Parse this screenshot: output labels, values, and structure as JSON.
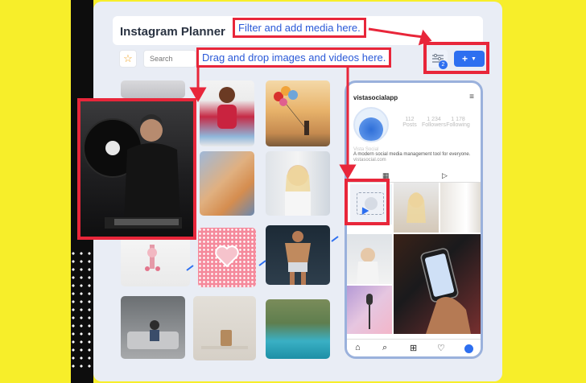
{
  "app": {
    "title": "Instagram Planner"
  },
  "toolbar": {
    "search_placeholder": "Search",
    "filter_count": "2",
    "add_label": "+",
    "add_caret": "▼"
  },
  "annotations": {
    "filter_note": "Filter and add media here.",
    "drag_note": "Drag and drop images and videos here."
  },
  "icons": {
    "star": "star-icon",
    "filter": "filter-icon",
    "plus": "plus-icon",
    "home": "home-icon",
    "search": "search-icon",
    "add": "add-post-icon",
    "heart": "heart-icon",
    "profile": "profile-icon",
    "grid": "grid-icon",
    "reels": "reels-icon",
    "menu": "menu-icon"
  },
  "phone": {
    "username": "vistasocialapp",
    "stats": [
      {
        "value": "112",
        "label": "Posts"
      },
      {
        "value": "1 234",
        "label": "Followers"
      },
      {
        "value": "1 178",
        "label": "Following"
      }
    ],
    "name": "Vista Social",
    "bio": "A modern social media management tool for everyone.",
    "website": "vistasocial.com",
    "nav_glyphs": {
      "home": "⌂",
      "search": "⌕",
      "add": "⊞",
      "heart": "♡",
      "menu": "≡",
      "grid": "▦",
      "reels": "▷"
    }
  },
  "colors": {
    "accent": "#2d6ff0",
    "annotation": "#e8263a",
    "annotation_text": "#2a59d8",
    "background": "#f7ee2a"
  }
}
